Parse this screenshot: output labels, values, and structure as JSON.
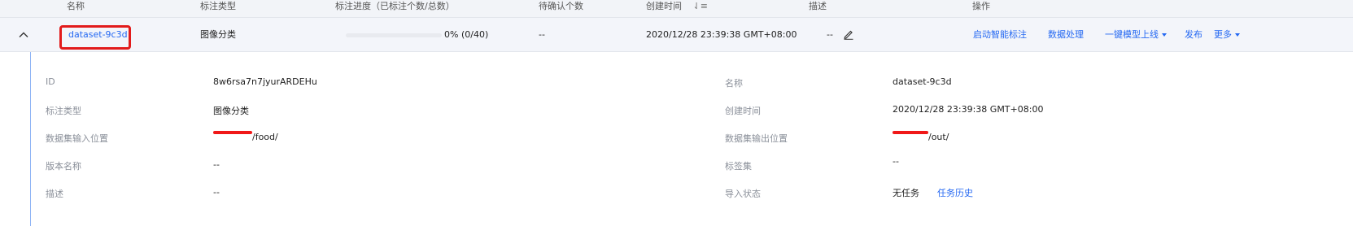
{
  "table": {
    "columns": {
      "name": "名称",
      "label_type": "标注类型",
      "progress": "标注进度（已标注个数/总数）",
      "pending": "待确认个数",
      "created": "创建时间",
      "sort_glyph": "⇃≡",
      "description": "描述",
      "actions": "操作"
    },
    "row": {
      "name": "dataset-9c3d",
      "label_type": "图像分类",
      "progress_text": "0% (0/40)",
      "progress_fraction": 0,
      "pending": "--",
      "created": "2020/12/28 23:39:38 GMT+08:00",
      "description": "--",
      "actions": {
        "smart_label": "启动智能标注",
        "data_process": "数据处理",
        "one_click_deploy": "一键模型上线",
        "publish": "发布",
        "more": "更多"
      }
    }
  },
  "detail": {
    "left": [
      {
        "label": "ID",
        "value": "8w6rsa7n7jyurARDEHu"
      },
      {
        "label": "标注类型",
        "value": "图像分类"
      },
      {
        "label": "数据集输入位置",
        "value": "/food/"
      },
      {
        "label": "版本名称",
        "value": "--"
      },
      {
        "label": "描述",
        "value": "--"
      }
    ],
    "right": [
      {
        "label": "名称",
        "value": "dataset-9c3d"
      },
      {
        "label": "创建时间",
        "value": "2020/12/28 23:39:38 GMT+08:00"
      },
      {
        "label": "数据集输出位置",
        "value": "/out/"
      },
      {
        "label": "标签集",
        "value": "--"
      },
      {
        "label": "导入状态",
        "value": "无任务",
        "link": "任务历史"
      }
    ]
  },
  "colors": {
    "accent": "#2468f2",
    "highlight_box": "#e21b1b",
    "redaction": "#f01818"
  },
  "icons": {
    "collapse": "chevron-up-icon",
    "edit": "pencil-icon",
    "sort": "sort-icon",
    "dropdown": "caret-down-icon"
  }
}
